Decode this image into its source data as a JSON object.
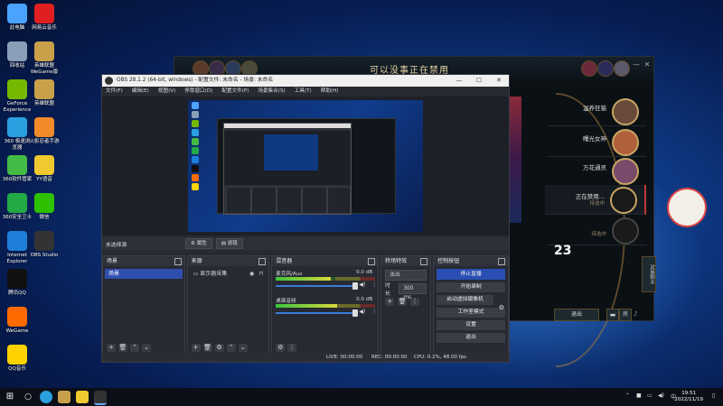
{
  "desktop": {
    "icons": [
      {
        "label": "此电脑",
        "color": "#4aa3ff"
      },
      {
        "label": "网易云音乐",
        "color": "#e02020"
      },
      {
        "label": "回收站",
        "color": "#8aa0b8"
      },
      {
        "label": "英雄联盟 WeGame版",
        "color": "#c9a04a"
      },
      {
        "label": "GeForce Experience",
        "color": "#76b900"
      },
      {
        "label": "英雄联盟",
        "color": "#c9a04a"
      },
      {
        "label": "360 极速浏览器",
        "color": "#2aa0e0"
      },
      {
        "label": "火影忍者手游",
        "color": "#f08a2a"
      },
      {
        "label": "360软件管家",
        "color": "#44bb44"
      },
      {
        "label": "YY语音",
        "color": "#f0c830"
      },
      {
        "label": "360安全卫士",
        "color": "#22aa44"
      },
      {
        "label": "微信",
        "color": "#2dc100"
      },
      {
        "label": "Internet Explorer",
        "color": "#1e7fd8"
      },
      {
        "label": "OBS Studio",
        "color": "#333333"
      },
      {
        "label": "腾讯QQ",
        "color": "#111111"
      },
      {
        "label": "WeGame",
        "color": "#ff6a00"
      },
      {
        "label": "QQ音乐",
        "color": "#ffd200"
      }
    ]
  },
  "game": {
    "banner": "可以没事正在禁用",
    "players": [
      {
        "name": "温养狂猫",
        "sub": ""
      },
      {
        "name": "曙光女神",
        "sub": ""
      },
      {
        "name": "万花通灵",
        "sub": ""
      },
      {
        "name": "正在禁用...",
        "sub": "待选中"
      },
      {
        "name": "",
        "sub": "待选中"
      }
    ],
    "timer": "23",
    "confirm_button": "退出",
    "side_tab": "对局聊天",
    "footer_buttons": [
      "房"
    ]
  },
  "obs": {
    "title": "OBS 28.1.2 (64-bit, windows) - 配置文件: 未命名 - 场景: 未命名",
    "menu": [
      "文件(F)",
      "编辑(E)",
      "视图(V)",
      "停靠窗口(D)",
      "配置文件(P)",
      "场景集合(S)",
      "工具(T)",
      "帮助(H)"
    ],
    "no_source": "未选择源",
    "props_button": "属性",
    "filters_button": "滤镜",
    "docks": {
      "scenes": {
        "title": "场景",
        "items": [
          "场景"
        ]
      },
      "sources": {
        "title": "来源",
        "items": [
          "显示器采集"
        ]
      },
      "mixer": {
        "title": "混音器",
        "channels": [
          {
            "name": "麦克风/Aux",
            "db": "0.0 dB",
            "level": 0.55
          },
          {
            "name": "桌面音频",
            "db": "0.0 dB",
            "level": 0.62
          }
        ]
      },
      "transitions": {
        "title": "转场特效",
        "type": "淡出",
        "duration_label": "时长",
        "duration": "300 ms"
      },
      "controls": {
        "title": "控制按钮",
        "buttons": [
          "停止直播",
          "开始录制",
          "启动虚拟摄像机",
          "工作室模式",
          "设置",
          "退出"
        ]
      }
    },
    "status": {
      "live": "LIVE: 00:00:00",
      "rec": "REC: 00:00:00",
      "cpu": "CPU: 0.2%, 48.00 fps"
    }
  },
  "taskbar": {
    "time": "19:51",
    "date": "2022/11/19"
  }
}
